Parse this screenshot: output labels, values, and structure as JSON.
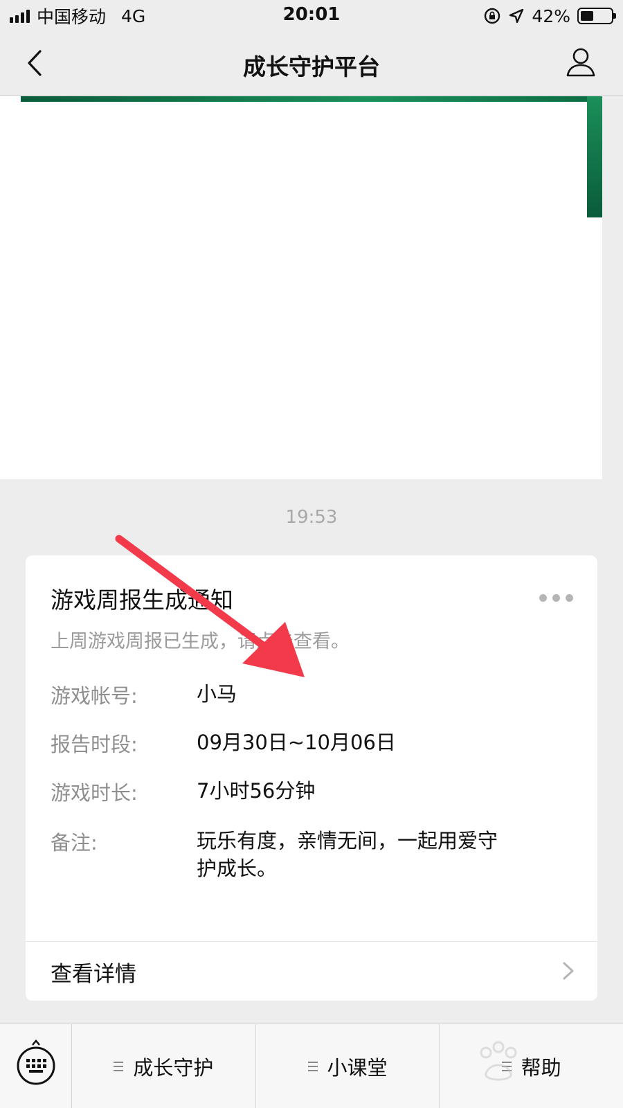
{
  "status_bar": {
    "carrier": "中国移动",
    "network": "4G",
    "time": "20:01",
    "battery_percent": "42%",
    "battery_level": 0.42,
    "icons": [
      "signal-icon",
      "orientation-lock-icon",
      "location-icon",
      "battery-icon"
    ]
  },
  "nav": {
    "title": "成长守护平台",
    "back_icon": "chevron-left-icon",
    "profile_icon": "person-icon"
  },
  "message_time": "19:53",
  "card": {
    "title": "游戏周报生成通知",
    "subtitle": "上周游戏周报已生成，请点击查看。",
    "fields": [
      {
        "label": "游戏帐号:",
        "value": "小马"
      },
      {
        "label": "报告时段:",
        "value": "09月30日~10月06日"
      },
      {
        "label": "游戏时长:",
        "value": "7小时56分钟"
      },
      {
        "label": "备注:",
        "value": "玩乐有度，亲情无间，一起用爱守护成长。"
      }
    ],
    "link_label": "查看详情"
  },
  "bottom_menu": {
    "keyboard_icon": "keyboard-icon",
    "items": [
      {
        "label": "成长守护"
      },
      {
        "label": "小课堂"
      },
      {
        "label": "帮助"
      }
    ]
  },
  "colors": {
    "background": "#ededed",
    "card": "#ffffff",
    "arrow": "#f23a4a",
    "green_banner": "#0a5c3a"
  }
}
